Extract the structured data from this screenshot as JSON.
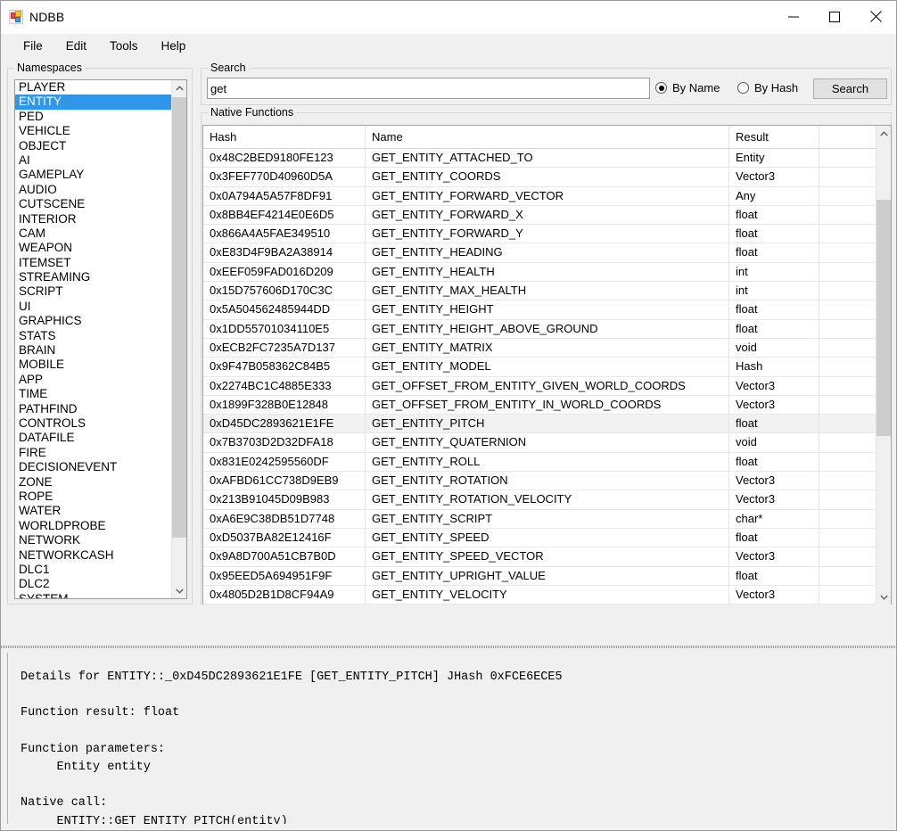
{
  "window": {
    "title": "NDBB",
    "icon": "app-squares-icon",
    "controls": {
      "minimize": "minimize-icon",
      "maximize": "maximize-icon",
      "close": "close-icon"
    }
  },
  "menubar": {
    "items": [
      {
        "label": "File"
      },
      {
        "label": "Edit"
      },
      {
        "label": "Tools"
      },
      {
        "label": "Help"
      }
    ]
  },
  "namespaces": {
    "group_label": "Namespaces",
    "selected": "ENTITY",
    "items": [
      "PLAYER",
      "ENTITY",
      "PED",
      "VEHICLE",
      "OBJECT",
      "AI",
      "GAMEPLAY",
      "AUDIO",
      "CUTSCENE",
      "INTERIOR",
      "CAM",
      "WEAPON",
      "ITEMSET",
      "STREAMING",
      "SCRIPT",
      "UI",
      "GRAPHICS",
      "STATS",
      "BRAIN",
      "MOBILE",
      "APP",
      "TIME",
      "PATHFIND",
      "CONTROLS",
      "DATAFILE",
      "FIRE",
      "DECISIONEVENT",
      "ZONE",
      "ROPE",
      "WATER",
      "WORLDPROBE",
      "NETWORK",
      "NETWORKCASH",
      "DLC1",
      "DLC2",
      "SYSTEM"
    ]
  },
  "search": {
    "group_label": "Search",
    "value": "get",
    "placeholder": "",
    "mode": "By Name",
    "options": [
      {
        "label": "By Name",
        "selected": true
      },
      {
        "label": "By Hash",
        "selected": false
      }
    ],
    "button_label": "Search"
  },
  "native_functions": {
    "group_label": "Native Functions",
    "columns": [
      "Hash",
      "Name",
      "Result",
      ""
    ],
    "selected_row_index": 14,
    "rows": [
      {
        "hash": "0x48C2BED9180FE123",
        "name": "GET_ENTITY_ATTACHED_TO",
        "result": "Entity",
        "extra": ""
      },
      {
        "hash": "0x3FEF770D40960D5A",
        "name": "GET_ENTITY_COORDS",
        "result": "Vector3",
        "extra": ""
      },
      {
        "hash": "0x0A794A5A57F8DF91",
        "name": "GET_ENTITY_FORWARD_VECTOR",
        "result": "Any",
        "extra": ""
      },
      {
        "hash": "0x8BB4EF4214E0E6D5",
        "name": "GET_ENTITY_FORWARD_X",
        "result": "float",
        "extra": ""
      },
      {
        "hash": "0x866A4A5FAE349510",
        "name": "GET_ENTITY_FORWARD_Y",
        "result": "float",
        "extra": ""
      },
      {
        "hash": "0xE83D4F9BA2A38914",
        "name": "GET_ENTITY_HEADING",
        "result": "float",
        "extra": ""
      },
      {
        "hash": "0xEEF059FAD016D209",
        "name": "GET_ENTITY_HEALTH",
        "result": "int",
        "extra": ""
      },
      {
        "hash": "0x15D757606D170C3C",
        "name": "GET_ENTITY_MAX_HEALTH",
        "result": "int",
        "extra": ""
      },
      {
        "hash": "0x5A504562485944DD",
        "name": "GET_ENTITY_HEIGHT",
        "result": "float",
        "extra": ""
      },
      {
        "hash": "0x1DD55701034110E5",
        "name": "GET_ENTITY_HEIGHT_ABOVE_GROUND",
        "result": "float",
        "extra": ""
      },
      {
        "hash": "0xECB2FC7235A7D137",
        "name": "GET_ENTITY_MATRIX",
        "result": "void",
        "extra": ""
      },
      {
        "hash": "0x9F47B058362C84B5",
        "name": "GET_ENTITY_MODEL",
        "result": "Hash",
        "extra": ""
      },
      {
        "hash": "0x2274BC1C4885E333",
        "name": "GET_OFFSET_FROM_ENTITY_GIVEN_WORLD_COORDS",
        "result": "Vector3",
        "extra": ""
      },
      {
        "hash": "0x1899F328B0E12848",
        "name": "GET_OFFSET_FROM_ENTITY_IN_WORLD_COORDS",
        "result": "Vector3",
        "extra": ""
      },
      {
        "hash": "0xD45DC2893621E1FE",
        "name": "GET_ENTITY_PITCH",
        "result": "float",
        "extra": ""
      },
      {
        "hash": "0x7B3703D2D32DFA18",
        "name": "GET_ENTITY_QUATERNION",
        "result": "void",
        "extra": ""
      },
      {
        "hash": "0x831E0242595560DF",
        "name": "GET_ENTITY_ROLL",
        "result": "float",
        "extra": ""
      },
      {
        "hash": "0xAFBD61CC738D9EB9",
        "name": "GET_ENTITY_ROTATION",
        "result": "Vector3",
        "extra": ""
      },
      {
        "hash": "0x213B91045D09B983",
        "name": "GET_ENTITY_ROTATION_VELOCITY",
        "result": "Vector3",
        "extra": ""
      },
      {
        "hash": "0xA6E9C38DB51D7748",
        "name": "GET_ENTITY_SCRIPT",
        "result": "char*",
        "extra": ""
      },
      {
        "hash": "0xD5037BA82E12416F",
        "name": "GET_ENTITY_SPEED",
        "result": "float",
        "extra": ""
      },
      {
        "hash": "0x9A8D700A51CB7B0D",
        "name": "GET_ENTITY_SPEED_VECTOR",
        "result": "Vector3",
        "extra": ""
      },
      {
        "hash": "0x95EED5A694951F9F",
        "name": "GET_ENTITY_UPRIGHT_VALUE",
        "result": "float",
        "extra": ""
      },
      {
        "hash": "0x4805D2B1D8CF94A9",
        "name": "GET_ENTITY_VELOCITY",
        "result": "Vector3",
        "extra": ""
      }
    ]
  },
  "details": {
    "text": "Details for ENTITY::_0xD45DC2893621E1FE [GET_ENTITY_PITCH] JHash 0xFCE6ECE5\n\nFunction result: float\n\nFunction parameters:\n     Entity entity\n\nNative call:\n     ENTITY::GET_ENTITY_PITCH(entity)"
  },
  "colors": {
    "selection_blue": "#2f96ea",
    "window_bg": "#f0f0f0",
    "row_selected_gray": "#f2f2f2",
    "scrollbar_thumb": "#cdcdcd"
  }
}
